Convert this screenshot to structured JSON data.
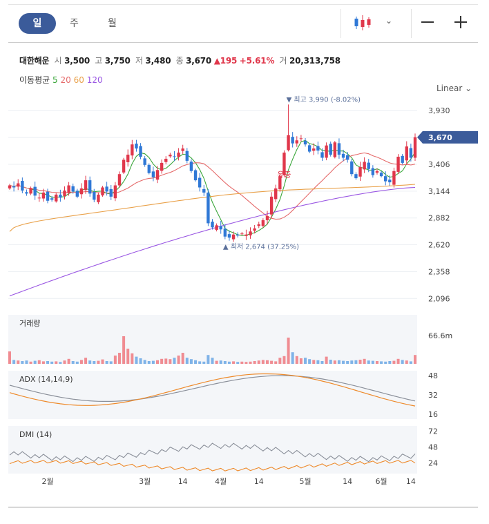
{
  "toolbar": {
    "period_tabs": [
      "일",
      "주",
      "월"
    ],
    "active_tab": "일",
    "chart_type_icon": "candlestick-icon",
    "dropdown_icon": "chevron-down-icon",
    "zoom_out_icon": "minus-icon",
    "zoom_in_icon": "plus-icon"
  },
  "stock": {
    "name": "대한해운",
    "open_label": "시",
    "open": "3,500",
    "high_label": "고",
    "high": "3,750",
    "low_label": "저",
    "low": "3,480",
    "close_label": "종",
    "close": "3,670",
    "change": "195",
    "change_pct": "+5.61%",
    "volume_label": "거",
    "volume": "20,313,758"
  },
  "ma_legend": {
    "label": "이동평균",
    "periods": [
      {
        "value": "5",
        "color": "#3aa63a"
      },
      {
        "value": "20",
        "color": "#e56a6a"
      },
      {
        "value": "60",
        "color": "#e9a14a"
      },
      {
        "value": "120",
        "color": "#9a57e3"
      }
    ]
  },
  "scale_label": "Linear",
  "colors": {
    "up": "#e0374b",
    "down": "#2f78d6",
    "up_vol": "#f08c92",
    "down_vol": "#7fb3e8",
    "accent": "#3b5b9a"
  },
  "chart_data": [
    {
      "type": "candlestick",
      "title": "대한해운",
      "ylim": [
        1990,
        4080
      ],
      "yticks": [
        "3,930",
        "3,668",
        "3,406",
        "3,144",
        "2,882",
        "2,620",
        "2,358",
        "2,096"
      ],
      "current_price": "3,670",
      "high_marker": "최고 3,990 (-8.02%)",
      "low_marker": "최저 2,674 (37.25%)",
      "annotation": "유증",
      "x_labels": [
        "2월",
        "3월",
        "14",
        "4월",
        "14",
        "5월",
        "14",
        "6월",
        "14"
      ],
      "closes": [
        3200,
        3180,
        3220,
        3150,
        3120,
        3170,
        3100,
        3080,
        3130,
        3050,
        3060,
        3110,
        3080,
        3150,
        3200,
        3140,
        3090,
        3170,
        3250,
        3120,
        3060,
        3110,
        3180,
        3140,
        3090,
        3200,
        3310,
        3450,
        3500,
        3600,
        3560,
        3480,
        3400,
        3320,
        3280,
        3350,
        3420,
        3460,
        3500,
        3480,
        3520,
        3560,
        3440,
        3340,
        3250,
        3180,
        3130,
        2830,
        2790,
        2810,
        2770,
        2700,
        2690,
        2720,
        2710,
        2730,
        2720,
        2750,
        2780,
        2820,
        2860,
        2900,
        3090,
        3170,
        3290,
        3520,
        3690,
        3610,
        3640,
        3660,
        3600,
        3530,
        3560,
        3540,
        3470,
        3590,
        3500,
        3620,
        3500,
        3470,
        3450,
        3310,
        3270,
        3380,
        3430,
        3360,
        3300,
        3340,
        3290,
        3240,
        3230,
        3340,
        3480,
        3420,
        3580,
        3470,
        3670
      ],
      "ma_series": [
        "5",
        "20",
        "60",
        "120"
      ],
      "volume_label": "거래량",
      "volume_max_tick": "66.6m",
      "volume": [
        0.45,
        0.14,
        0.12,
        0.1,
        0.12,
        0.08,
        0.11,
        0.13,
        0.09,
        0.1,
        0.08,
        0.09,
        0.07,
        0.12,
        0.18,
        0.1,
        0.08,
        0.14,
        0.22,
        0.12,
        0.1,
        0.11,
        0.16,
        0.1,
        0.09,
        0.3,
        0.4,
        1.0,
        0.55,
        0.38,
        0.26,
        0.2,
        0.14,
        0.1,
        0.11,
        0.13,
        0.18,
        0.19,
        0.17,
        0.22,
        0.3,
        0.4,
        0.22,
        0.17,
        0.13,
        0.09,
        0.08,
        0.32,
        0.22,
        0.11,
        0.12,
        0.1,
        0.08,
        0.09,
        0.07,
        0.08,
        0.07,
        0.08,
        0.1,
        0.12,
        0.14,
        0.13,
        0.11,
        0.09,
        0.22,
        0.28,
        0.95,
        0.42,
        0.28,
        0.2,
        0.22,
        0.17,
        0.14,
        0.13,
        0.1,
        0.26,
        0.15,
        0.12,
        0.13,
        0.11,
        0.1,
        0.12,
        0.13,
        0.15,
        0.18,
        0.12,
        0.11,
        0.1,
        0.09,
        0.08,
        0.1,
        0.11,
        0.18,
        0.14,
        0.12,
        0.09,
        0.32
      ],
      "adx_label": "ADX (14,14,9)",
      "adx_ylim": [
        12,
        52
      ],
      "adx_ticks": [
        "48",
        "32",
        "16"
      ],
      "dmi_label": "DMI (14)",
      "dmi_ylim": [
        8,
        80
      ],
      "dmi_ticks": [
        "72",
        "48",
        "24"
      ]
    }
  ]
}
